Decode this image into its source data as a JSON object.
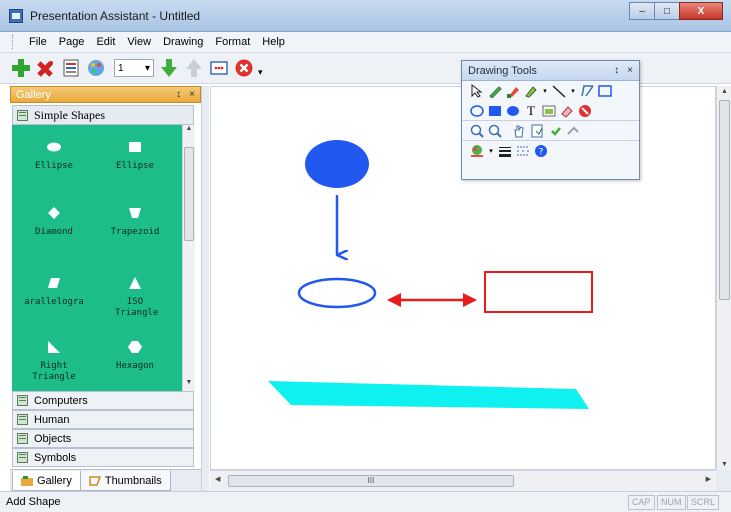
{
  "window": {
    "title": "Presentation Assistant - Untitled",
    "minimize": "–",
    "maximize": "□",
    "close": "X"
  },
  "menu": {
    "items": [
      "File",
      "Page",
      "Edit",
      "View",
      "Drawing",
      "Format",
      "Help"
    ]
  },
  "toolbar": {
    "page_number": "1"
  },
  "gallery": {
    "title": "Gallery",
    "pin": "↕",
    "close": "×",
    "active_category": "Simple Shapes",
    "shapes": [
      "Ellipse",
      "Ellipse",
      "Diamond",
      "Trapezoid",
      "arallelogra",
      "ISO Triangle",
      "Right Triangle",
      "Hexagon"
    ],
    "categories": [
      "Computers",
      "Human",
      "Objects",
      "Symbols"
    ],
    "tabs": [
      "Gallery",
      "Thumbnails"
    ]
  },
  "drawing_tools": {
    "title": "Drawing Tools",
    "pin": "↕",
    "close": "×"
  },
  "hscroll": {
    "thumb_grip": "III"
  },
  "status": {
    "text": "Add Shape",
    "cap": "CAP",
    "num": "NUM",
    "scrl": "SCRL"
  },
  "colors": {
    "gallery_bg": "#1dbd8a",
    "gallery_header": "#e8a93a",
    "shape_blue": "#2158f0",
    "shape_red": "#e81c1c",
    "shape_cyan": "#0ff0f0"
  }
}
